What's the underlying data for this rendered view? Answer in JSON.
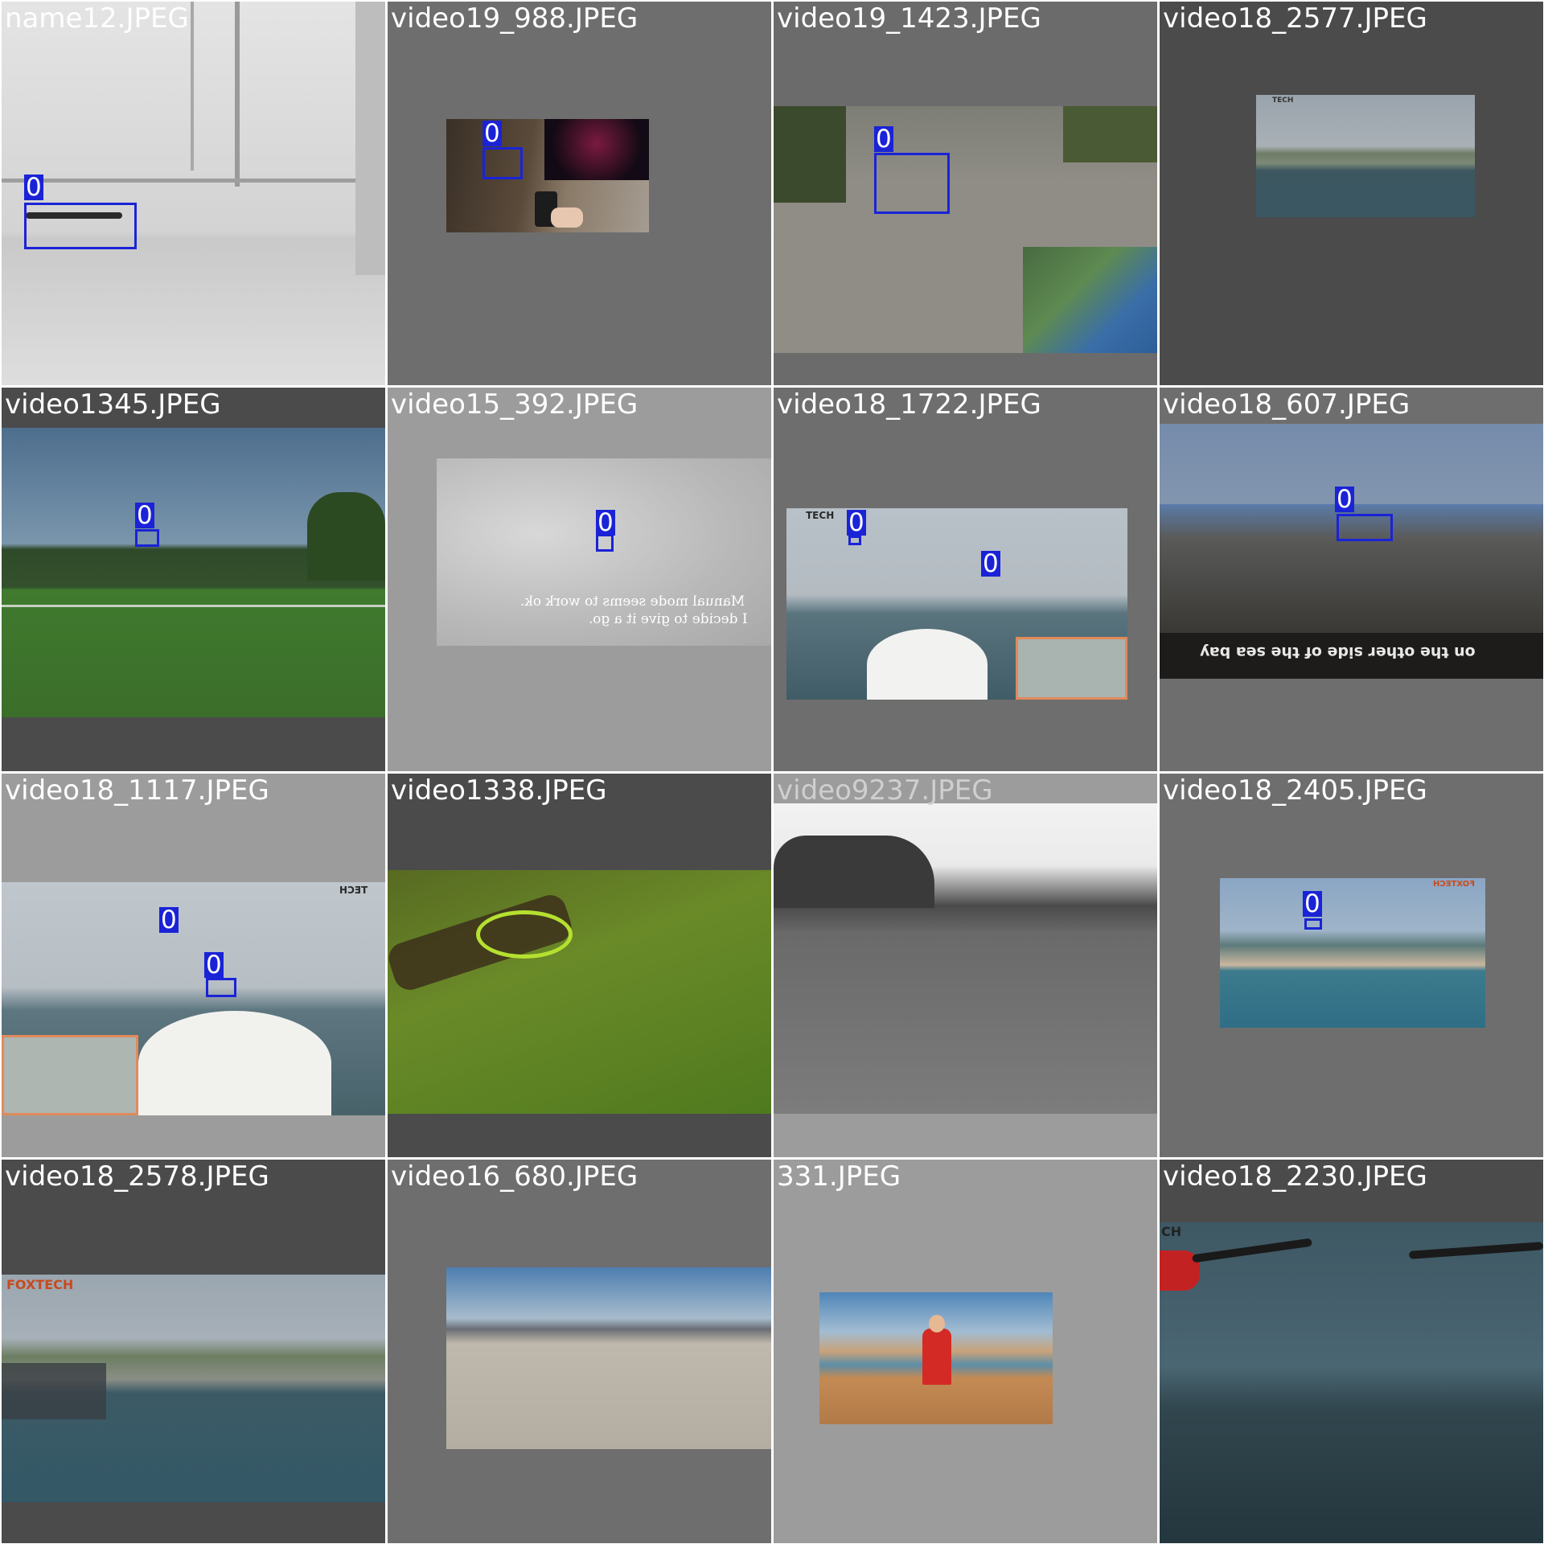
{
  "tiles": [
    {
      "filename": "name12.JPEG",
      "labels": [
        "0"
      ]
    },
    {
      "filename": "video19_988.JPEG",
      "labels": [
        "0"
      ]
    },
    {
      "filename": "video19_1423.JPEG",
      "labels": [
        "0"
      ]
    },
    {
      "filename": "video18_2577.JPEG",
      "labels": []
    },
    {
      "filename": "video1345.JPEG",
      "labels": [
        "0"
      ]
    },
    {
      "filename": "video15_392.JPEG",
      "labels": [
        "0"
      ],
      "caption_lines": [
        "Manual mode seems to work ok.",
        "I decide to give it a go."
      ]
    },
    {
      "filename": "video18_1722.JPEG",
      "labels": [
        "0",
        "0"
      ],
      "logo": "TECH"
    },
    {
      "filename": "video18_607.JPEG",
      "labels": [
        "0"
      ],
      "caption": "on the other side of the sea bay"
    },
    {
      "filename": "video18_1117.JPEG",
      "labels": [
        "0",
        "0"
      ],
      "logo": "TECH"
    },
    {
      "filename": "video1338.JPEG",
      "labels": []
    },
    {
      "filename": "video9237.JPEG",
      "labels": []
    },
    {
      "filename": "video18_2405.JPEG",
      "labels": [
        "0"
      ],
      "logo": "FOXTECH"
    },
    {
      "filename": "video18_2578.JPEG",
      "labels": [],
      "logo": "FOXTECH"
    },
    {
      "filename": "video16_680.JPEG",
      "labels": []
    },
    {
      "filename": "331.JPEG",
      "labels": []
    },
    {
      "filename": "video18_2230.JPEG",
      "labels": [],
      "logo": "CH"
    }
  ],
  "colors": {
    "box": "#1a23d6",
    "label_text": "#ffffff"
  }
}
